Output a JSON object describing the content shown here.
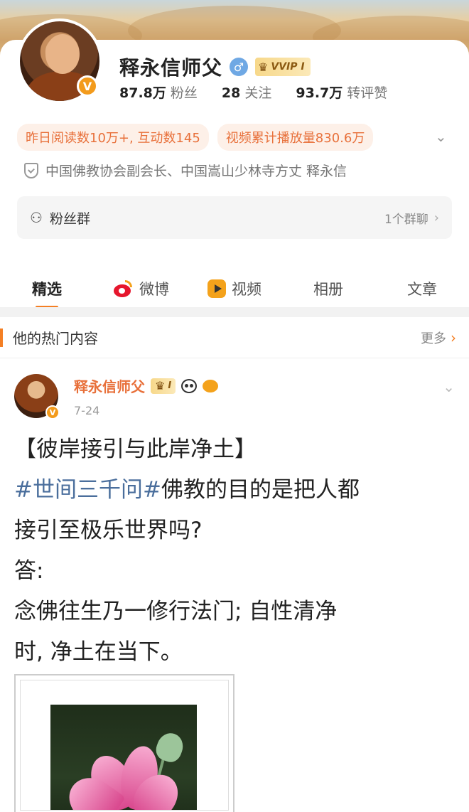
{
  "profile": {
    "name": "释永信师父",
    "vip_label": "VVIP I",
    "stats": [
      {
        "value": "87.8万",
        "label": "粉丝"
      },
      {
        "value": "28",
        "label": "关注"
      },
      {
        "value": "93.7万",
        "label": "转评赞"
      }
    ],
    "tags": [
      "昨日阅读数10万+, 互动数145",
      "视频累计播放量830.6万"
    ],
    "certification": "中国佛教协会副会长、中国嵩山少林寺方丈 释永信",
    "fan_group": {
      "label": "粉丝群",
      "count": "1个群聊"
    }
  },
  "tabs": [
    {
      "label": "精选",
      "icon": ""
    },
    {
      "label": "微博",
      "icon": "weibo-icon"
    },
    {
      "label": "视频",
      "icon": "video-icon"
    },
    {
      "label": "相册",
      "icon": ""
    },
    {
      "label": "文章",
      "icon": ""
    }
  ],
  "hot": {
    "title": "他的热门内容",
    "more": "更多"
  },
  "post": {
    "author": "释永信师父",
    "vip_label": "I",
    "time": "7-24",
    "line1": "【彼岸接引与此岸净土】",
    "topic": "#世间三千问#",
    "line2_rest": "佛教的目的是把人都",
    "line3": "接引至极乐世界吗?",
    "line4": "答:",
    "line5": "念佛往生乃一修行法门; 自性清净",
    "line6": "时, 净土在当下。"
  },
  "colors": {
    "accent": "#f47f24",
    "topic": "#4a6e9c",
    "tag_text": "#e8703a"
  }
}
